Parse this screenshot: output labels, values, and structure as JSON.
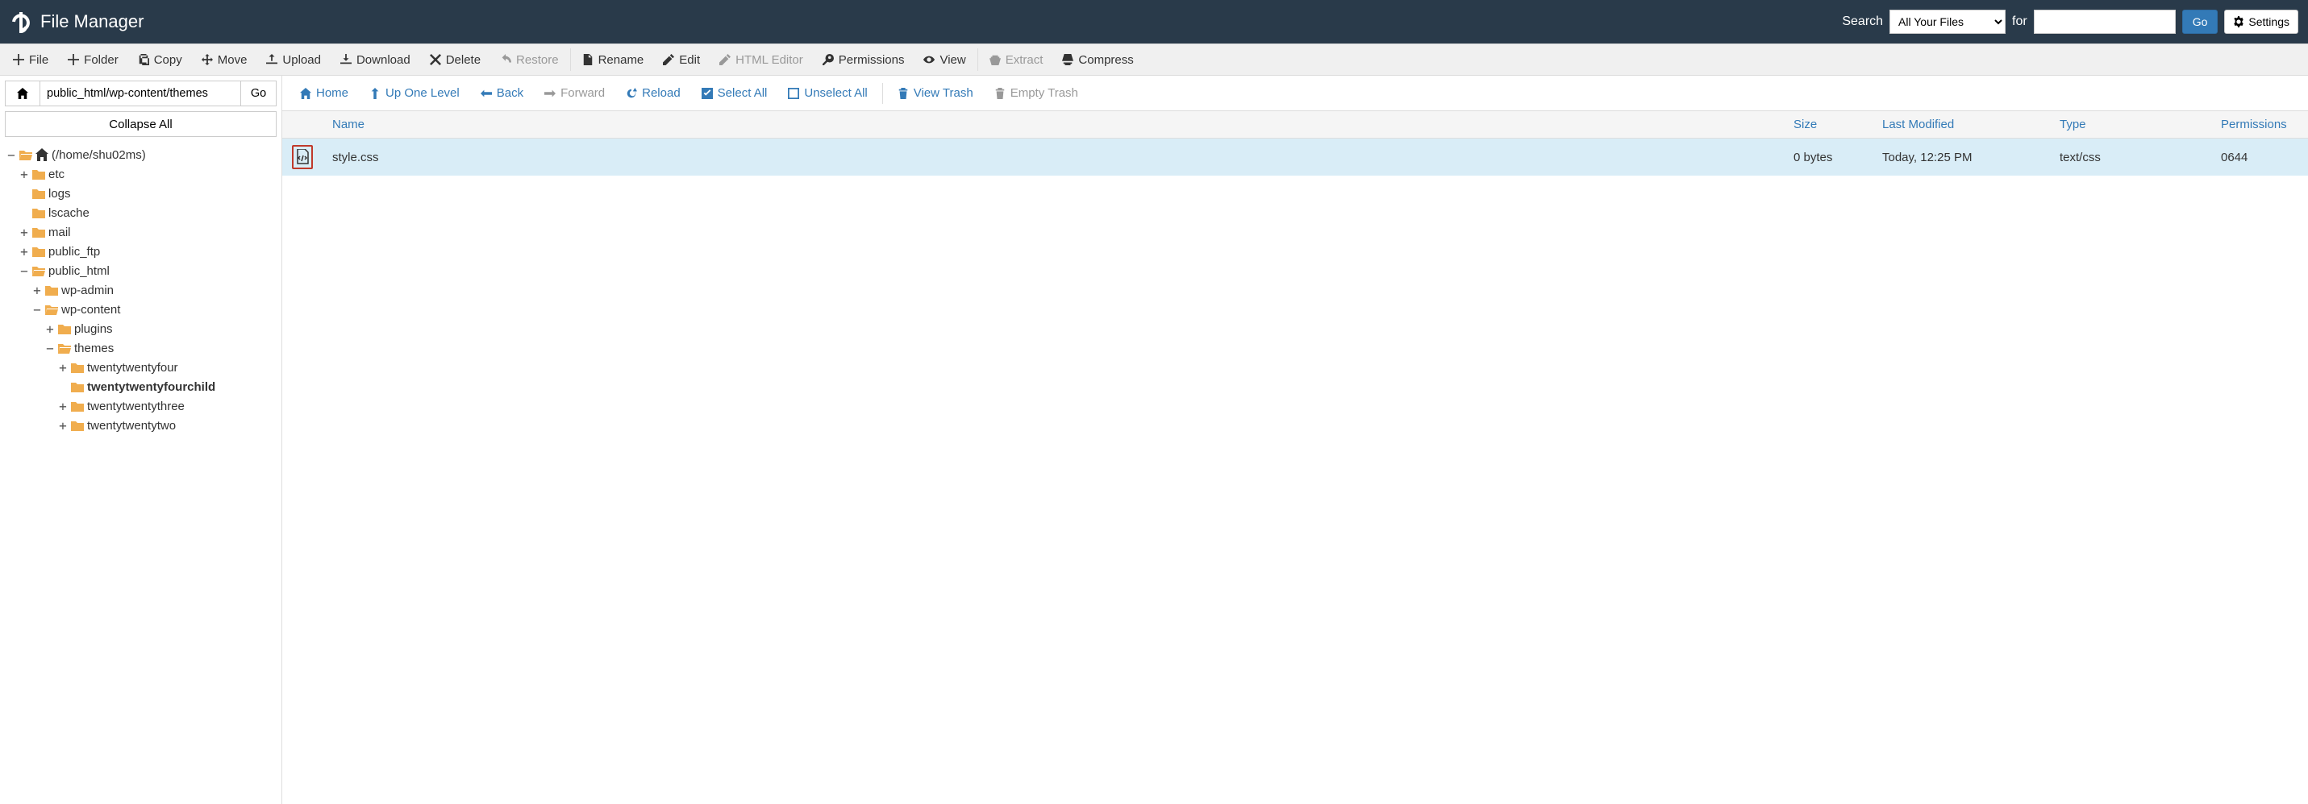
{
  "header": {
    "title": "File Manager",
    "search_label": "Search",
    "select_value": "All Your Files",
    "for_label": "for",
    "search_value": "",
    "go_label": "Go",
    "settings_label": "Settings"
  },
  "toolbar": {
    "file": "File",
    "folder": "Folder",
    "copy": "Copy",
    "move": "Move",
    "upload": "Upload",
    "download": "Download",
    "delete": "Delete",
    "restore": "Restore",
    "rename": "Rename",
    "edit": "Edit",
    "html_editor": "HTML Editor",
    "permissions": "Permissions",
    "view": "View",
    "extract": "Extract",
    "compress": "Compress"
  },
  "sidebar": {
    "path_value": "public_html/wp-content/themes",
    "go_label": "Go",
    "collapse_label": "Collapse All",
    "tree": {
      "root_label": "(/home/shu02ms)",
      "etc": "etc",
      "logs": "logs",
      "lscache": "lscache",
      "mail": "mail",
      "public_ftp": "public_ftp",
      "public_html": "public_html",
      "wp_admin": "wp-admin",
      "wp_content": "wp-content",
      "plugins": "plugins",
      "themes": "themes",
      "tt_four": "twentytwentyfour",
      "tt_four_child": "twentytwentyfourchild",
      "tt_three": "twentytwentythree",
      "tt_two": "twentytwentytwo"
    }
  },
  "content_toolbar": {
    "home": "Home",
    "up_one": "Up One Level",
    "back": "Back",
    "forward": "Forward",
    "reload": "Reload",
    "select_all": "Select All",
    "unselect_all": "Unselect All",
    "view_trash": "View Trash",
    "empty_trash": "Empty Trash"
  },
  "table": {
    "headers": {
      "name": "Name",
      "size": "Size",
      "last_modified": "Last Modified",
      "type": "Type",
      "permissions": "Permissions"
    },
    "rows": [
      {
        "name": "style.css",
        "size": "0 bytes",
        "last_modified": "Today, 12:25 PM",
        "type": "text/css",
        "permissions": "0644"
      }
    ]
  }
}
